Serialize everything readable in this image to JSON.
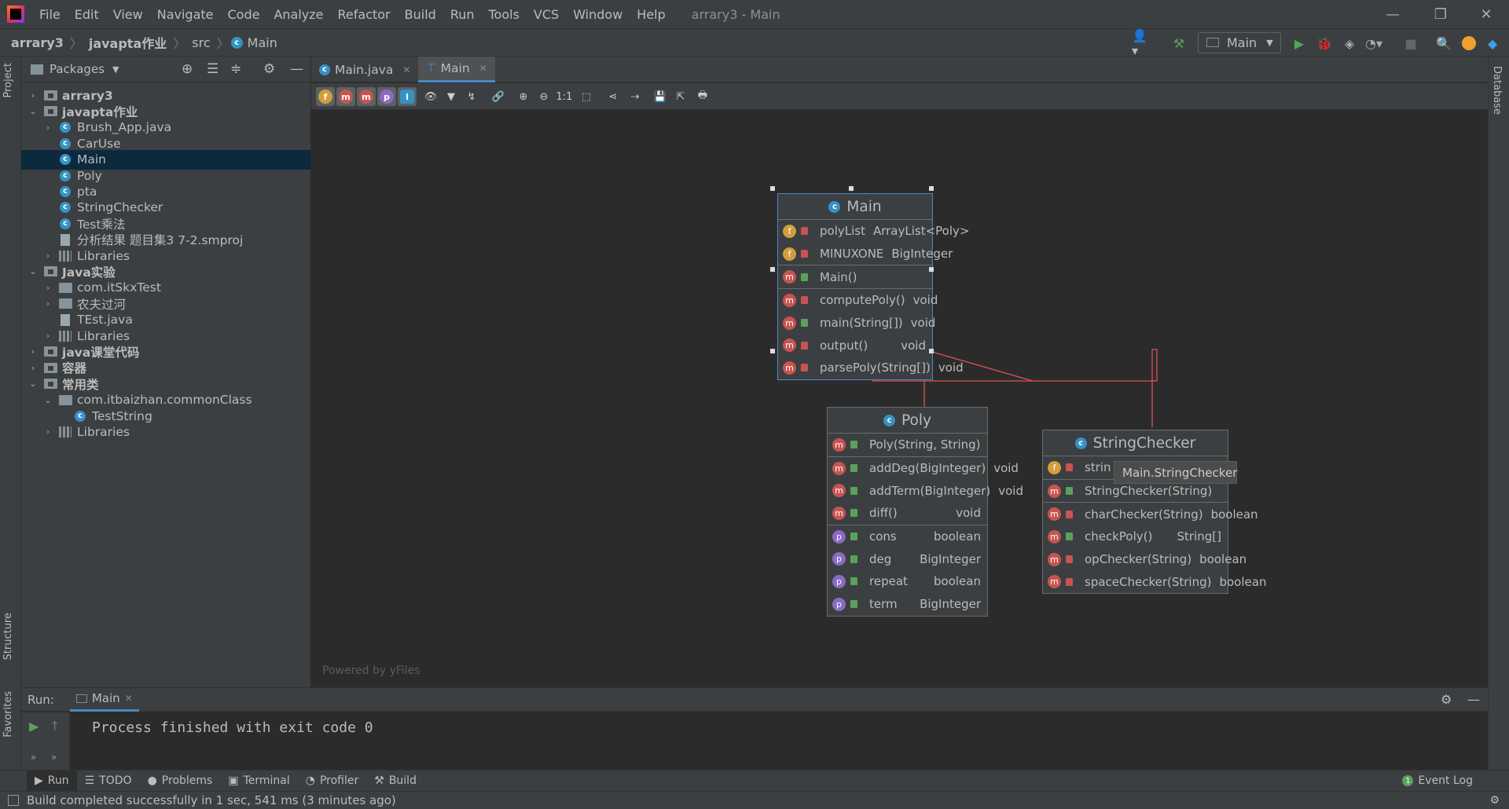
{
  "menu": [
    "File",
    "Edit",
    "View",
    "Navigate",
    "Code",
    "Analyze",
    "Refactor",
    "Build",
    "Run",
    "Tools",
    "VCS",
    "Window",
    "Help"
  ],
  "window_title": "arrary3 - Main",
  "breadcrumb": {
    "project": "arrary3",
    "module": "javapta作业",
    "src": "src",
    "cls": "Main"
  },
  "run_config": "Main",
  "project_panel": {
    "title": "Packages"
  },
  "tree": [
    {
      "label": "arrary3",
      "depth": 0,
      "arrow": "›",
      "icon": "folder",
      "bold": true
    },
    {
      "label": "javapta作业",
      "depth": 0,
      "arrow": "⌄",
      "icon": "folder",
      "bold": true
    },
    {
      "label": "Brush_App.java",
      "depth": 1,
      "arrow": "›",
      "icon": "class"
    },
    {
      "label": "CarUse",
      "depth": 1,
      "arrow": "",
      "icon": "class"
    },
    {
      "label": "Main",
      "depth": 1,
      "arrow": "",
      "icon": "class",
      "selected": true
    },
    {
      "label": "Poly",
      "depth": 1,
      "arrow": "",
      "icon": "class"
    },
    {
      "label": "pta",
      "depth": 1,
      "arrow": "",
      "icon": "class"
    },
    {
      "label": "StringChecker",
      "depth": 1,
      "arrow": "",
      "icon": "class"
    },
    {
      "label": "Test乘法",
      "depth": 1,
      "arrow": "",
      "icon": "class"
    },
    {
      "label": "分析结果 题目集3 7-2.smproj",
      "depth": 1,
      "arrow": "",
      "icon": "file"
    },
    {
      "label": "Libraries",
      "depth": 1,
      "arrow": "›",
      "icon": "libs"
    },
    {
      "label": "Java实验",
      "depth": 0,
      "arrow": "⌄",
      "icon": "folder",
      "bold": true
    },
    {
      "label": "com.itSkxTest",
      "depth": 1,
      "arrow": "›",
      "icon": "pkg"
    },
    {
      "label": "农夫过河",
      "depth": 1,
      "arrow": "›",
      "icon": "pkg"
    },
    {
      "label": "TEst.java",
      "depth": 1,
      "arrow": "",
      "icon": "file"
    },
    {
      "label": "Libraries",
      "depth": 1,
      "arrow": "›",
      "icon": "libs"
    },
    {
      "label": "java课堂代码",
      "depth": 0,
      "arrow": "›",
      "icon": "folder",
      "bold": true
    },
    {
      "label": "容器",
      "depth": 0,
      "arrow": "›",
      "icon": "folder",
      "bold": true
    },
    {
      "label": "常用类",
      "depth": 0,
      "arrow": "⌄",
      "icon": "folder",
      "bold": true
    },
    {
      "label": "com.itbaizhan.commonClass",
      "depth": 1,
      "arrow": "⌄",
      "icon": "pkg"
    },
    {
      "label": "TestString",
      "depth": 2,
      "arrow": "",
      "icon": "class"
    },
    {
      "label": "Libraries",
      "depth": 1,
      "arrow": "›",
      "icon": "libs"
    }
  ],
  "tabs": [
    {
      "label": "Main.java",
      "icon": "class"
    },
    {
      "label": "Main",
      "icon": "diagram",
      "active": true
    }
  ],
  "diagram": {
    "powered_by": "Powered by yFiles",
    "tooltip": "Main.StringChecker",
    "classes": {
      "main": {
        "name": "Main",
        "fields": [
          {
            "kind": "f",
            "vis": "priv",
            "name": "polyList",
            "type": "ArrayList<Poly>"
          },
          {
            "kind": "f",
            "vis": "priv",
            "name": "MINUXONE",
            "type": "BigInteger"
          }
        ],
        "ctors": [
          {
            "kind": "m",
            "vis": "pub",
            "name": "Main()",
            "type": ""
          }
        ],
        "methods": [
          {
            "kind": "m",
            "vis": "priv",
            "name": "computePoly()",
            "type": "void"
          },
          {
            "kind": "m",
            "vis": "pub",
            "name": "main(String[])",
            "type": "void"
          },
          {
            "kind": "m",
            "vis": "priv",
            "name": "output()",
            "type": "void"
          },
          {
            "kind": "m",
            "vis": "priv",
            "name": "parsePoly(String[])",
            "type": "void"
          }
        ]
      },
      "poly": {
        "name": "Poly",
        "ctors": [
          {
            "kind": "m",
            "vis": "pub",
            "name": "Poly(String, String)",
            "type": ""
          }
        ],
        "methods": [
          {
            "kind": "m",
            "vis": "pub",
            "name": "addDeg(BigInteger)",
            "type": "void"
          },
          {
            "kind": "m",
            "vis": "pub",
            "name": "addTerm(BigInteger)",
            "type": "void"
          },
          {
            "kind": "m",
            "vis": "pub",
            "name": "diff()",
            "type": "void"
          }
        ],
        "props": [
          {
            "kind": "p",
            "vis": "pub",
            "name": "cons",
            "type": "boolean"
          },
          {
            "kind": "p",
            "vis": "pub",
            "name": "deg",
            "type": "BigInteger"
          },
          {
            "kind": "p",
            "vis": "pub",
            "name": "repeat",
            "type": "boolean"
          },
          {
            "kind": "p",
            "vis": "pub",
            "name": "term",
            "type": "BigInteger"
          }
        ]
      },
      "checker": {
        "name": "StringChecker",
        "fields": [
          {
            "kind": "f",
            "vis": "priv",
            "name": "strin",
            "type": "ing"
          }
        ],
        "ctors": [
          {
            "kind": "m",
            "vis": "pub",
            "name": "StringChecker(String)",
            "type": ""
          }
        ],
        "methods": [
          {
            "kind": "m",
            "vis": "priv",
            "name": "charChecker(String)",
            "type": "boolean"
          },
          {
            "kind": "m",
            "vis": "pub",
            "name": "checkPoly()",
            "type": "String[]"
          },
          {
            "kind": "m",
            "vis": "priv",
            "name": "opChecker(String)",
            "type": "boolean"
          },
          {
            "kind": "m",
            "vis": "priv",
            "name": "spaceChecker(String)",
            "type": "boolean"
          }
        ]
      }
    }
  },
  "run": {
    "label": "Run:",
    "tab": "Main",
    "output": "Process finished with exit code 0"
  },
  "bottom_tools": [
    "Run",
    "TODO",
    "Problems",
    "Terminal",
    "Profiler",
    "Build"
  ],
  "event_log": "Event Log",
  "status": "Build completed successfully in 1 sec, 541 ms (3 minutes ago)",
  "side_labels": {
    "project": "Project",
    "structure": "Structure",
    "favorites": "Favorites",
    "database": "Database"
  },
  "colors": {
    "accent": "#4a88c7",
    "method": "#c75450",
    "field": "#d29e3c",
    "property": "#8a6bc4",
    "class": "#3592c4",
    "edge": "#d9534f"
  }
}
